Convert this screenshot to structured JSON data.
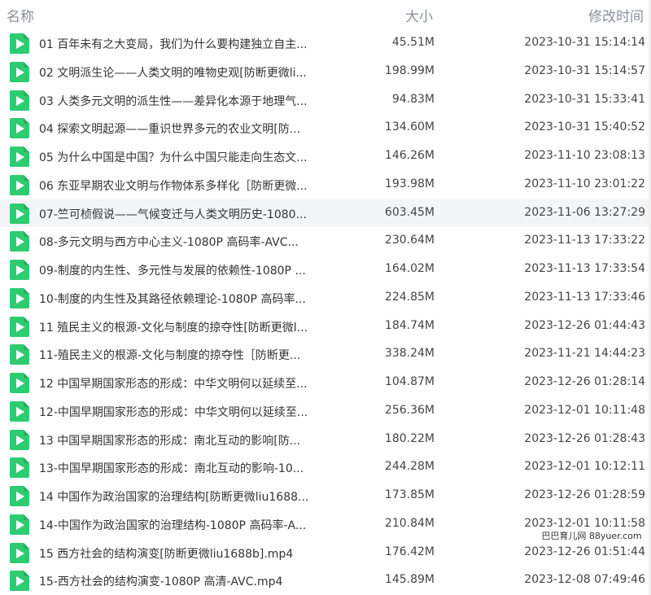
{
  "header": {
    "name": "名称",
    "size": "大小",
    "modified": "修改时间"
  },
  "icon": "video-file-play-icon",
  "accent": "#2ecc71",
  "highlighted_row": 6,
  "watermark": "巴巴育儿网 88yuer.com",
  "files": [
    {
      "name": "01 百年未有之大变局，我们为什么要构建独立自主...",
      "size": "45.51M",
      "modified": "2023-10-31 15:14:14"
    },
    {
      "name": "02 文明派生论——人类文明的唯物史观[防断更微li...",
      "size": "198.99M",
      "modified": "2023-10-31 15:14:57"
    },
    {
      "name": "03 人类多元文明的派生性——差异化本源于地理气...",
      "size": "94.83M",
      "modified": "2023-10-31 15:33:41"
    },
    {
      "name": "04 探索文明起源——重识世界多元的农业文明[防...",
      "size": "134.60M",
      "modified": "2023-10-31 15:40:52"
    },
    {
      "name": "05 为什么中国是中国？为什么中国只能走向生态文...",
      "size": "146.26M",
      "modified": "2023-11-10 23:08:13"
    },
    {
      "name": "06 东亚早期农业文明与作物体系多样化［防断更微...",
      "size": "193.98M",
      "modified": "2023-11-10 23:01:22"
    },
    {
      "name": "07-竺可桢假说——气候变迁与人类文明历史-1080...",
      "size": "603.45M",
      "modified": "2023-11-06 13:27:29"
    },
    {
      "name": "08-多元文明与西方中心主义-1080P 高码率-AVC...",
      "size": "230.64M",
      "modified": "2023-11-13 17:33:22"
    },
    {
      "name": "09-制度的内生性、多元性与发展的依赖性-1080P ...",
      "size": "164.02M",
      "modified": "2023-11-13 17:33:54"
    },
    {
      "name": "10-制度的内生性及其路径依赖理论-1080P 高码率...",
      "size": "224.85M",
      "modified": "2023-11-13 17:33:46"
    },
    {
      "name": "11 殖民主义的根源-文化与制度的掠夺性[防断更微l...",
      "size": "184.74M",
      "modified": "2023-12-26 01:44:43"
    },
    {
      "name": "11-殖民主义的根源-文化与制度的掠夺性［防断更...",
      "size": "338.24M",
      "modified": "2023-11-21 14:44:23"
    },
    {
      "name": "12 中国早期国家形态的形成：中华文明何以延续至...",
      "size": "104.87M",
      "modified": "2023-12-26 01:28:14"
    },
    {
      "name": "12-中国早期国家形态的形成：中华文明何以延续至...",
      "size": "256.36M",
      "modified": "2023-12-01 10:11:48"
    },
    {
      "name": "13 中国早期国家形态的形成：南北互动的影响[防...",
      "size": "180.22M",
      "modified": "2023-12-26 01:28:43"
    },
    {
      "name": "13-中国早期国家形态的形成：南北互动的影响-10...",
      "size": "244.28M",
      "modified": "2023-12-01 10:12:11"
    },
    {
      "name": "14 中国作为政治国家的治理结构[防断更微liu1688...",
      "size": "173.85M",
      "modified": "2023-12-26 01:28:59"
    },
    {
      "name": "14-中国作为政治国家的治理结构-1080P 高码率-A...",
      "size": "210.84M",
      "modified": "2023-12-01 10:11:58"
    },
    {
      "name": "15 西方社会的结构演变[防断更微liu1688b].mp4",
      "size": "176.42M",
      "modified": "2023-12-26 01:51:44"
    },
    {
      "name": "15-西方社会的结构演变-1080P 高清-AVC.mp4",
      "size": "145.89M",
      "modified": "2023-12-08 07:49:46"
    }
  ]
}
